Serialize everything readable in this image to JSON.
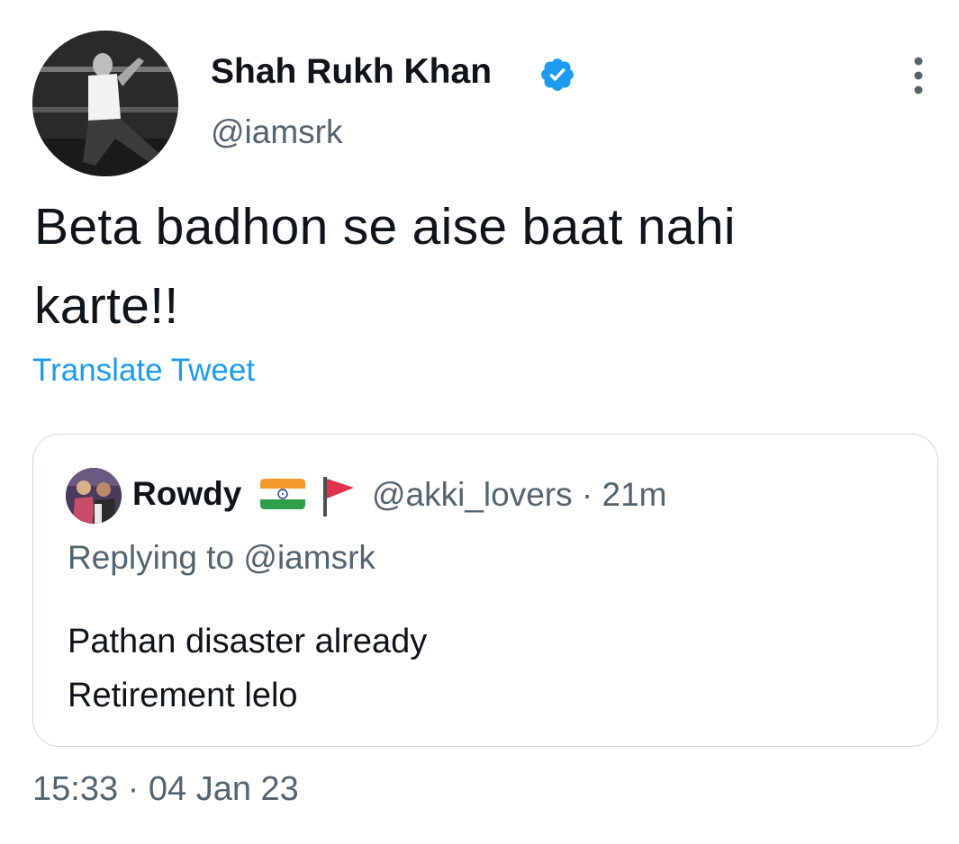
{
  "tweet": {
    "author": {
      "display_name": "Shah Rukh Khan",
      "handle": "@iamsrk",
      "verified": true,
      "avatar_icon": "profile-photo"
    },
    "text": "Beta badhon se aise baat nahi\nkarte!!",
    "translate_label": "Translate Tweet",
    "timestamp": "15:33 · 04 Jan 23"
  },
  "quoted": {
    "display_name": "Rowdy",
    "name_emoji": [
      "flag-india-icon",
      "red-flag-icon"
    ],
    "handle_time": "@akki_lovers · 21m",
    "reply_to": "Replying to @iamsrk",
    "text": "Pathan disaster already\nRetirement lelo"
  },
  "colors": {
    "accent": "#1d9bf0",
    "muted_text": "#536471",
    "primary_text": "#0f1419",
    "border": "#cfd9de"
  }
}
